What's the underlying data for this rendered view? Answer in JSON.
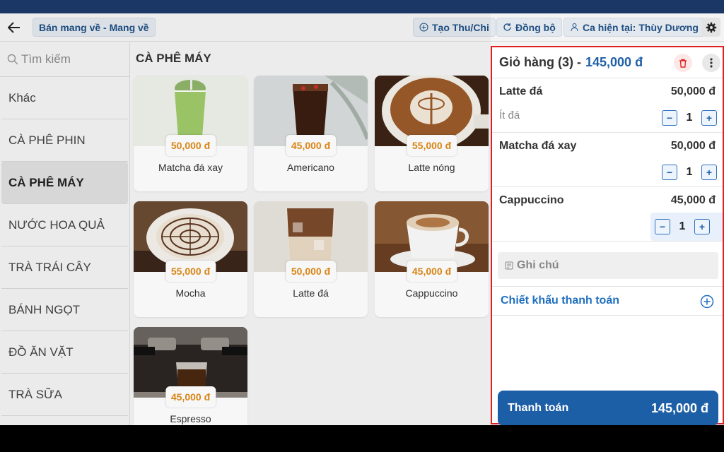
{
  "header": {
    "mode_chip": "Bán mang về - Mang về",
    "create_button": "Tạo Thu/Chi",
    "sync_button": "Đồng bộ",
    "shift_button": "Ca hiện tại: Thùy Dương"
  },
  "sidebar": {
    "search_placeholder": "Tìm kiếm",
    "categories": [
      {
        "label": "Khác"
      },
      {
        "label": "CÀ PHÊ PHIN"
      },
      {
        "label": "CÀ PHÊ MÁY"
      },
      {
        "label": "NƯỚC HOA QUẢ"
      },
      {
        "label": "TRÀ TRÁI CÂY"
      },
      {
        "label": "BÁNH NGỌT"
      },
      {
        "label": "ĐỒ ĂN VẶT"
      },
      {
        "label": "TRÀ SỮA"
      }
    ],
    "active_category": "CÀ PHÊ MÁY"
  },
  "products": {
    "section_title": "CÀ PHÊ MÁY",
    "items": [
      {
        "name": "Matcha đá xay",
        "price": "50,000 đ"
      },
      {
        "name": "Americano",
        "price": "45,000 đ"
      },
      {
        "name": "Latte nóng",
        "price": "55,000 đ"
      },
      {
        "name": "Mocha",
        "price": "55,000 đ"
      },
      {
        "name": "Latte đá",
        "price": "50,000 đ"
      },
      {
        "name": "Cappuccino",
        "price": "45,000 đ"
      },
      {
        "name": "Espresso",
        "price": "45,000 đ"
      }
    ]
  },
  "cart": {
    "title": "Giỏ hàng (3) -",
    "total": "145,000 đ",
    "items": [
      {
        "name": "Latte đá",
        "price": "50,000 đ",
        "note": "Ít đá",
        "qty": "1"
      },
      {
        "name": "Matcha đá xay",
        "price": "50,000 đ",
        "note": "",
        "qty": "1"
      },
      {
        "name": "Cappuccino",
        "price": "45,000 đ",
        "note": "",
        "qty": "1"
      }
    ],
    "minus": "−",
    "plus": "+",
    "note_placeholder": "Ghi chú",
    "discount_label": "Chiết khấu thanh toán",
    "pay_label": "Thanh toán",
    "pay_total": "145,000 đ"
  },
  "colors": {
    "accent": "#1d5fa6",
    "price_orange": "#e08a16",
    "highlight_border": "#e02020",
    "top_strip": "#1b3766"
  }
}
